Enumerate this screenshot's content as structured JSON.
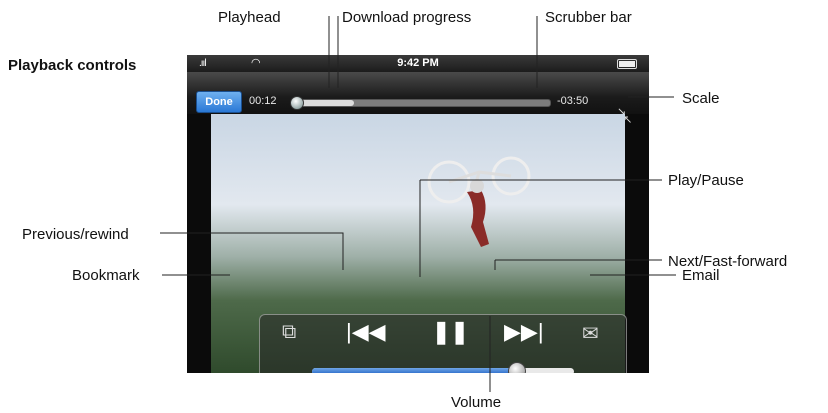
{
  "heading": "Playback controls",
  "callouts": {
    "playhead": "Playhead",
    "download_progress": "Download progress",
    "scrubber_bar": "Scrubber bar",
    "scale": "Scale",
    "play_pause": "Play/Pause",
    "previous_rewind": "Previous/rewind",
    "next_fast_forward": "Next/Fast-forward",
    "bookmark": "Bookmark",
    "email": "Email",
    "volume": "Volume"
  },
  "status_bar": {
    "time": "9:42 PM",
    "signal_icon": "signal-bars-icon",
    "wifi_icon": "wifi-icon",
    "battery_icon": "battery-icon"
  },
  "top_bar": {
    "done_label": "Done",
    "elapsed": "00:12",
    "remaining": "-03:50",
    "playhead_fraction": 0.02,
    "download_fraction": 0.24,
    "scale_icon": "scale-icon"
  },
  "controls": {
    "bookmark_icon": "bookmark-icon",
    "previous_icon": "previous-rewind-icon",
    "pause_icon": "pause-icon",
    "next_icon": "next-fast-forward-icon",
    "email_icon": "email-icon",
    "volume_fraction": 0.78
  }
}
